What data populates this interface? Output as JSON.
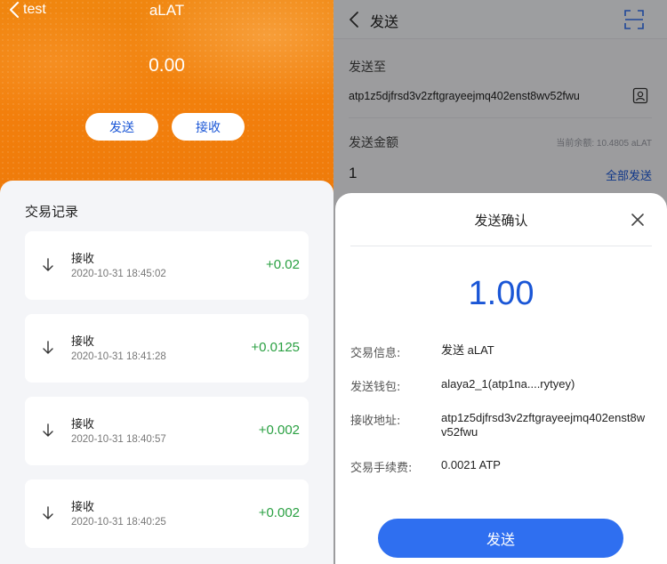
{
  "wallet": {
    "back_label": "test",
    "token_title": "aLAT",
    "balance": "0.00",
    "send_label": "发送",
    "receive_label": "接收",
    "records_title": "交易记录",
    "records": [
      {
        "type": "接收",
        "time": "2020-10-31 18:45:02",
        "amount": "+0.02"
      },
      {
        "type": "接收",
        "time": "2020-10-31 18:41:28",
        "amount": "+0.0125"
      },
      {
        "type": "接收",
        "time": "2020-10-31 18:40:57",
        "amount": "+0.002"
      },
      {
        "type": "接收",
        "time": "2020-10-31 18:40:25",
        "amount": "+0.002"
      }
    ]
  },
  "send_form": {
    "title": "发送",
    "to_label": "发送至",
    "to_address": "atp1z5djfrsd3v2zftgrayeejmq402enst8wv52fwu",
    "amount_label": "发送金额",
    "balance_hint": "当前余额: 10.4805 aLAT",
    "amount_value": "1",
    "send_all_label": "全部发送"
  },
  "confirm_dialog": {
    "title": "发送确认",
    "amount": "1.00",
    "rows": [
      {
        "label": "交易信息:",
        "value": "发送 aLAT"
      },
      {
        "label": "发送钱包:",
        "value": "alaya2_1(atp1na....rytyey)"
      },
      {
        "label": "接收地址:",
        "value": "atp1z5djfrsd3v2zftgrayeejmq402enst8wv52fwu"
      },
      {
        "label": "交易手续费:",
        "value": "0.0021 ATP"
      }
    ],
    "confirm_label": "发送"
  },
  "colors": {
    "brand_orange": "#f08010",
    "accent_blue": "#1a56d6",
    "positive_green": "#2aa042"
  }
}
